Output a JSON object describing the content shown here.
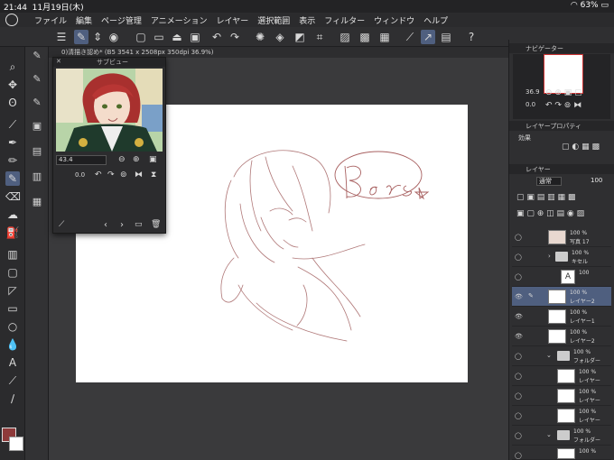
{
  "status": {
    "time": "21:44",
    "date": "11月19日(木)",
    "battery": "63%"
  },
  "menu": [
    "ファイル",
    "編集",
    "ページ管理",
    "アニメーション",
    "レイヤー",
    "選択範囲",
    "表示",
    "フィルター",
    "ウィンドウ",
    "ヘルプ"
  ],
  "document": {
    "tab_title": "0)清描き認め* (B5 3541 x 2508px 350dpi 36.9%)"
  },
  "subview": {
    "title": "サブビュー",
    "zoom": "43.4",
    "rotation": "0.0"
  },
  "navigator": {
    "title": "ナビゲーター",
    "zoom": "36.9",
    "rotation": "0.0"
  },
  "layer_property": {
    "title": "レイヤープロパティ",
    "effect_label": "効果"
  },
  "layers_panel": {
    "title": "レイヤー",
    "blend_mode": "通常",
    "opacity": "100",
    "rows": [
      {
        "pct": "100 %",
        "name": "写真 17",
        "type": "image"
      },
      {
        "pct": "100 %",
        "name": "キセル",
        "type": "folder"
      },
      {
        "pct": "100",
        "name": "",
        "type": "text"
      },
      {
        "pct": "100 %",
        "name": "レイヤー2",
        "type": "raster",
        "selected": true
      },
      {
        "pct": "100 %",
        "name": "レイヤー1",
        "type": "raster"
      },
      {
        "pct": "100 %",
        "name": "レイヤー2",
        "type": "raster"
      },
      {
        "pct": "100 %",
        "name": "フォルダー",
        "type": "folder"
      },
      {
        "pct": "100 %",
        "name": "レイヤー",
        "type": "raster"
      },
      {
        "pct": "100 %",
        "name": "レイヤー",
        "type": "raster"
      },
      {
        "pct": "100 %",
        "name": "レイヤー",
        "type": "raster"
      },
      {
        "pct": "100 %",
        "name": "フォルダー",
        "type": "folder"
      },
      {
        "pct": "100 %",
        "name": "レイヤー",
        "type": "raster"
      }
    ]
  },
  "sketch_text": "Bears"
}
